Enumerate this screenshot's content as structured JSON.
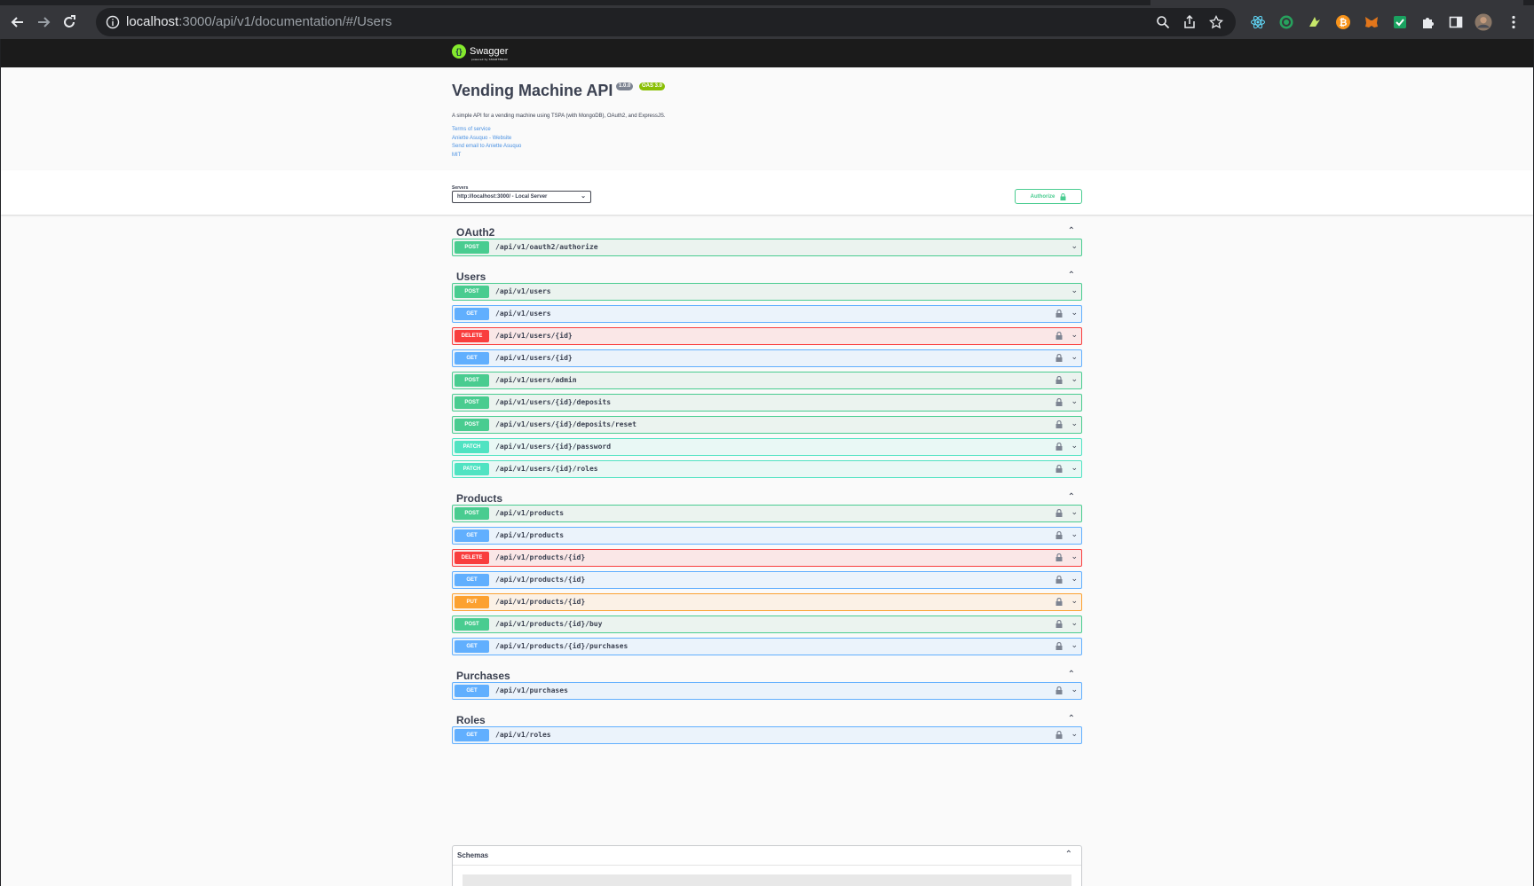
{
  "browser": {
    "url_host": "localhost",
    "url_rest": ":3000/api/v1/documentation/#/Users"
  },
  "swagger": {
    "logo_text": "Swagger",
    "logo_sub": "powered by SMARTBEAR"
  },
  "info": {
    "title": "Vending Machine API",
    "version_badge": "1.0.0",
    "oas_badge": "OAS 3.0",
    "description": "A simple API for a vending machine using TSPA (with MongoDB), OAuth2, and ExpressJS.",
    "links": [
      "Terms of service",
      "Aniette Asuquo - Website",
      "Send email to Aniette Asuquo",
      "MIT"
    ]
  },
  "servers": {
    "label": "Servers",
    "selected": "http://localhost:3000/ - Local Server"
  },
  "authorize_label": "Authorize",
  "tags": [
    {
      "name": "OAuth2",
      "ops": [
        {
          "method": "POST",
          "path": "/api/v1/oauth2/authorize",
          "locked": false
        }
      ]
    },
    {
      "name": "Users",
      "ops": [
        {
          "method": "POST",
          "path": "/api/v1/users",
          "locked": false
        },
        {
          "method": "GET",
          "path": "/api/v1/users",
          "locked": true
        },
        {
          "method": "DELETE",
          "path": "/api/v1/users/{id}",
          "locked": true
        },
        {
          "method": "GET",
          "path": "/api/v1/users/{id}",
          "locked": true
        },
        {
          "method": "POST",
          "path": "/api/v1/users/admin",
          "locked": true
        },
        {
          "method": "POST",
          "path": "/api/v1/users/{id}/deposits",
          "locked": true
        },
        {
          "method": "POST",
          "path": "/api/v1/users/{id}/deposits/reset",
          "locked": true
        },
        {
          "method": "PATCH",
          "path": "/api/v1/users/{id}/password",
          "locked": true
        },
        {
          "method": "PATCH",
          "path": "/api/v1/users/{id}/roles",
          "locked": true
        }
      ]
    },
    {
      "name": "Products",
      "ops": [
        {
          "method": "POST",
          "path": "/api/v1/products",
          "locked": true
        },
        {
          "method": "GET",
          "path": "/api/v1/products",
          "locked": true
        },
        {
          "method": "DELETE",
          "path": "/api/v1/products/{id}",
          "locked": true
        },
        {
          "method": "GET",
          "path": "/api/v1/products/{id}",
          "locked": true
        },
        {
          "method": "PUT",
          "path": "/api/v1/products/{id}",
          "locked": true
        },
        {
          "method": "POST",
          "path": "/api/v1/products/{id}/buy",
          "locked": true
        },
        {
          "method": "GET",
          "path": "/api/v1/products/{id}/purchases",
          "locked": true
        }
      ]
    },
    {
      "name": "Purchases",
      "ops": [
        {
          "method": "GET",
          "path": "/api/v1/purchases",
          "locked": true
        }
      ]
    },
    {
      "name": "Roles",
      "ops": [
        {
          "method": "GET",
          "path": "/api/v1/roles",
          "locked": true
        }
      ]
    }
  ],
  "schemas_label": "Schemas",
  "colors": {
    "post": "#49cc90",
    "get": "#61affe",
    "delete": "#f93e3e",
    "patch": "#50e3c2",
    "put": "#fca130"
  },
  "icons": {
    "extensions": [
      "react-devtools-icon",
      "target-icon",
      "bird-icon",
      "bitcoin-icon",
      "metamask-icon",
      "green-check-icon",
      "puzzle-icon",
      "sidebar-icon",
      "profile-avatar"
    ]
  }
}
